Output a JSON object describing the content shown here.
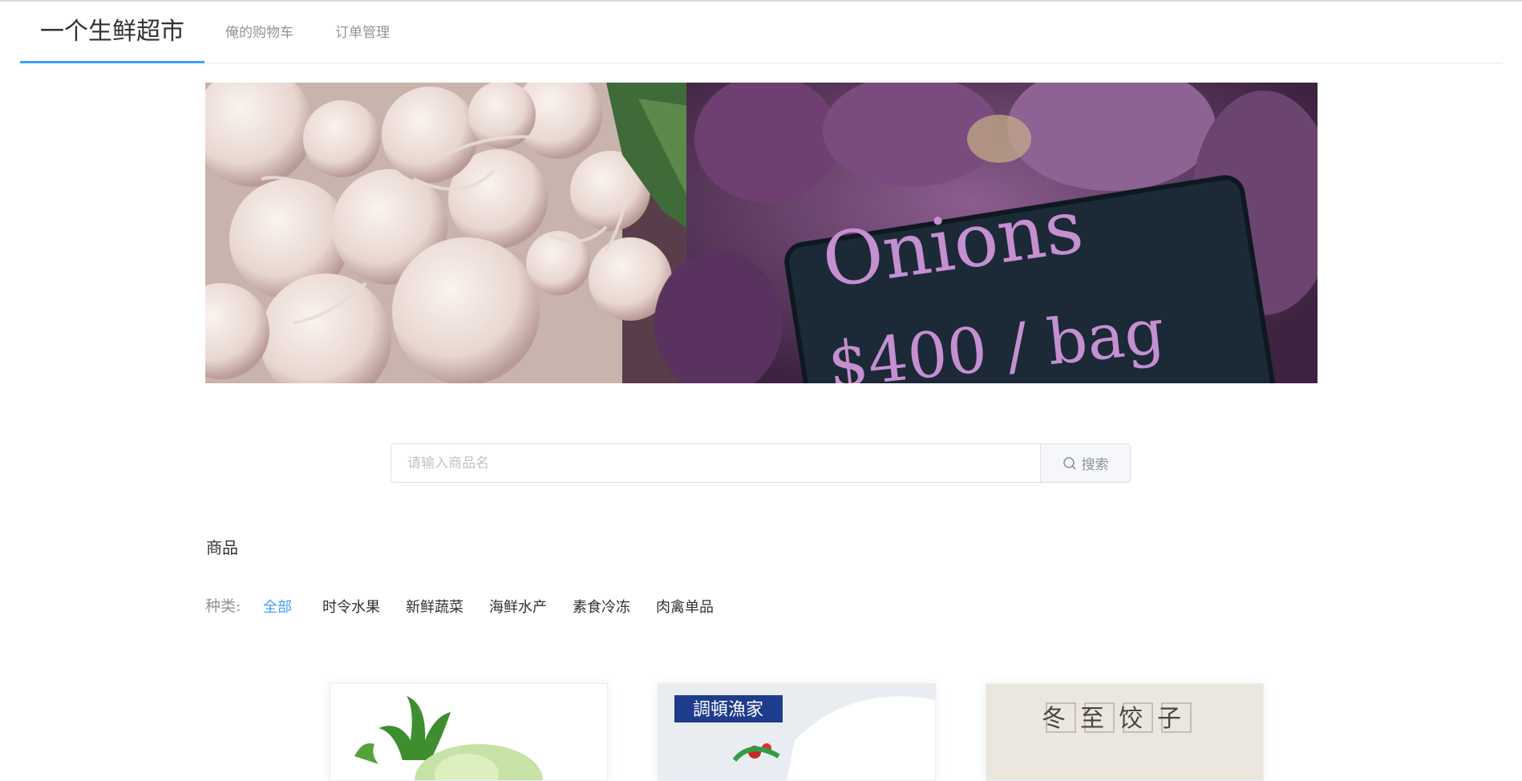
{
  "nav": {
    "brand": "一个生鲜超市",
    "cart": "俺的购物车",
    "orders": "订单管理"
  },
  "banner": {
    "sign_text": "Onions",
    "price_text": "$400 / bag"
  },
  "search": {
    "placeholder": "请输入商品名",
    "button_label": "搜索"
  },
  "products_section": {
    "title": "商品",
    "category_label": "种类:",
    "categories": [
      "全部",
      "时令水果",
      "新鲜蔬菜",
      "海鲜水产",
      "素食冷冻",
      "肉禽单品"
    ],
    "active_category": "全部"
  },
  "product_cards": [
    {
      "image": "white-radish"
    },
    {
      "image": "seafood-chef",
      "overlay_text": "調頓漁家"
    },
    {
      "image": "dumplings",
      "overlay_text": "冬至饺子"
    }
  ],
  "colors": {
    "accent": "#409eff",
    "muted": "#909399",
    "border": "#dcdfe6"
  },
  "icons": {
    "search": "search-icon"
  }
}
